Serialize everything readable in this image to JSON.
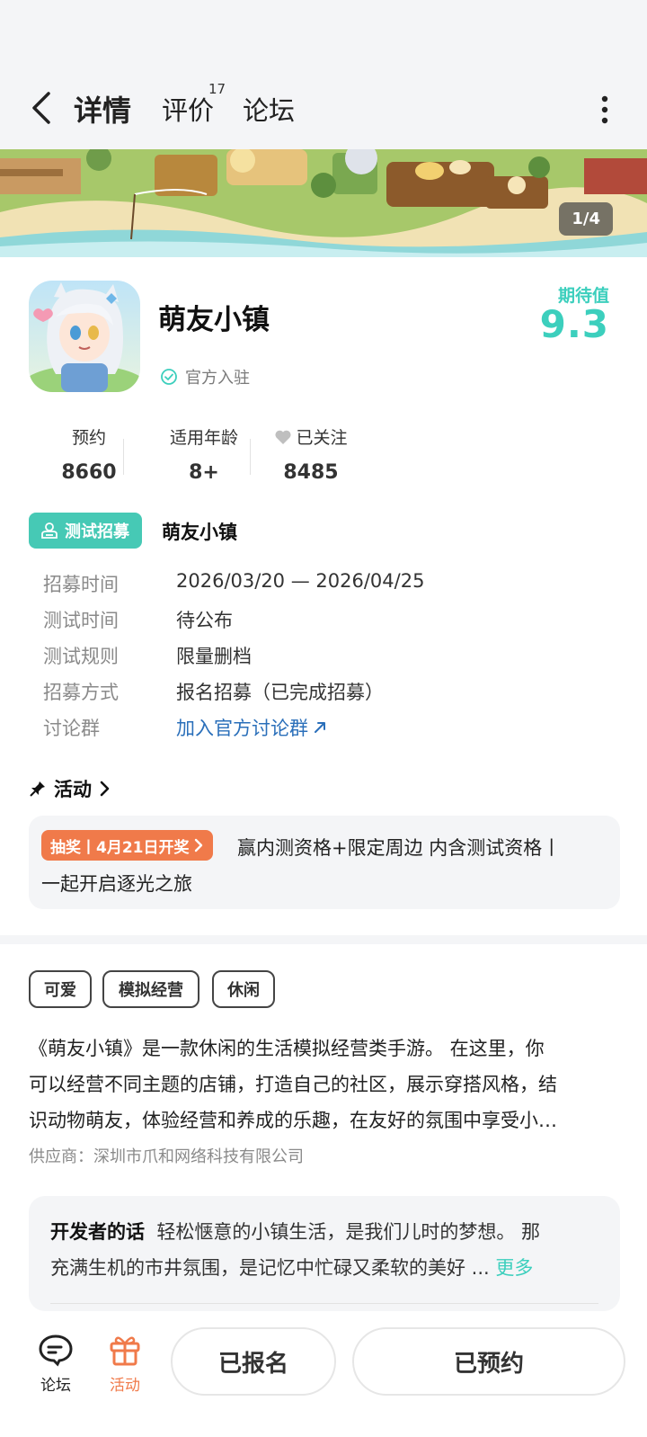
{
  "topnav": {
    "tabs": [
      {
        "label": "详情",
        "active": true
      },
      {
        "label": "评价",
        "badge": "17"
      },
      {
        "label": "论坛"
      }
    ]
  },
  "banner": {
    "counter": "1/4"
  },
  "app": {
    "name": "萌友小镇",
    "official_label": "官方入驻",
    "expect_label": "期待值",
    "expect_score": "9.3"
  },
  "stats": [
    {
      "label": "预约",
      "value": "8660"
    },
    {
      "label": "适用年龄",
      "value": "8+"
    },
    {
      "label": "已关注",
      "value": "8485"
    }
  ],
  "recruit": {
    "badge": "测试招募",
    "title": "萌友小镇",
    "rows": [
      {
        "key": "招募时间",
        "value": "2026/03/20 — 2026/04/25"
      },
      {
        "key": "测试时间",
        "value": "待公布"
      },
      {
        "key": "测试规则",
        "value": "限量删档"
      },
      {
        "key": "招募方式",
        "value": "报名招募（已完成招募）"
      },
      {
        "key": "讨论群",
        "value": "加入官方讨论群"
      }
    ]
  },
  "activity": {
    "header": "活动",
    "badge": "抽奖丨4月21日开奖",
    "line1": "赢内测资格+限定周边 内含测试资格丨",
    "line2": "一起开启逐光之旅"
  },
  "tags": [
    "可爱",
    "模拟经营",
    "休闲"
  ],
  "description": {
    "line1": "《萌友小镇》是一款休闲的生活模拟经营类手游。 在这里，你",
    "line2": "可以经营不同主题的店铺，打造自己的社区，展示穿搭风格，结",
    "line3": "识动物萌友，体验经营和养成的乐趣，在友好的氛围中享受小…"
  },
  "supplier": "供应商：深圳市爪和网络科技有限公司",
  "developer": {
    "lead": "开发者的话",
    "text1": "轻松惬意的小镇生活，是我们儿时的梦想。 那",
    "text2": "充满生机的市井氛围，是记忆中忙碌又柔软的美好 ...",
    "more": "更多"
  },
  "bottom": {
    "forum_label": "论坛",
    "activity_label": "活动",
    "signed_button": "已报名",
    "reserved_button": "已预约"
  },
  "colors": {
    "accent": "#3ccfbd",
    "recruit_badge": "#46c9b5",
    "lottery_badge": "#f07a4a",
    "link": "#2a6fba"
  },
  "icons": [
    "back-arrow-icon",
    "more-vertical-icon",
    "check-circle-icon",
    "heart-icon",
    "recruit-icon",
    "pin-icon",
    "chevron-right-icon",
    "external-link-icon",
    "forum-icon",
    "gift-icon"
  ]
}
